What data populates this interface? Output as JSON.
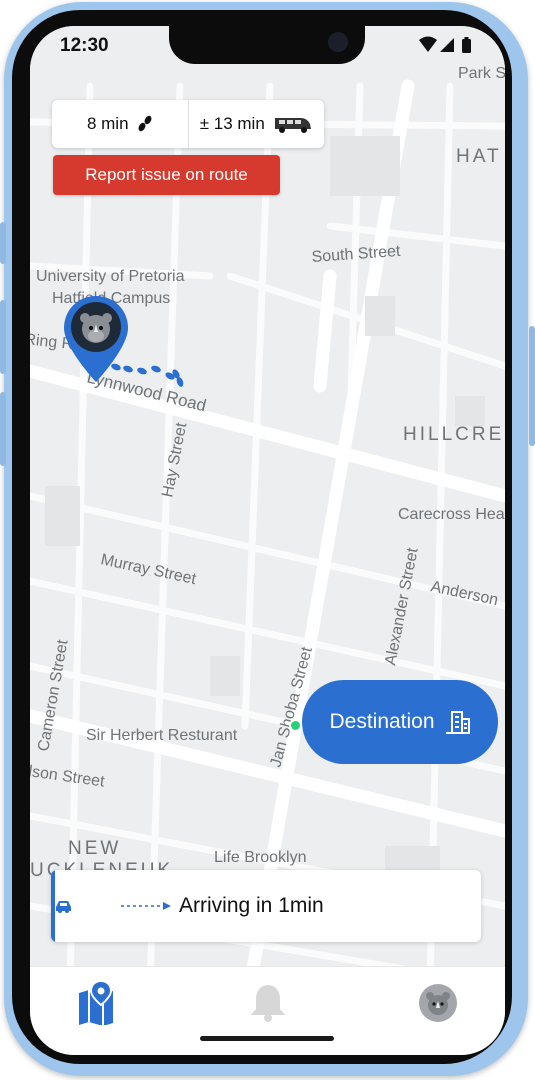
{
  "status_bar": {
    "time": "12:30"
  },
  "eta": {
    "walk": "8 min",
    "taxi": "± 13 min"
  },
  "report_button": {
    "label": "Report issue on route"
  },
  "map": {
    "labels": {
      "park": "Park S",
      "hat": "HAT",
      "south_street": "South Street",
      "university_1": "University of Pretoria",
      "university_2": "Hatfield Campus",
      "ring": "Ring R",
      "lynnwood": "Lynnwood Road",
      "hillcrest": "HILLCRE",
      "hay": "Hay Street",
      "carecross": "Carecross Hea",
      "murray": "Murray Street",
      "anderson": "Anderson",
      "alexander": "Alexander Street",
      "cameron": "Cameron Street",
      "jan_shoba": "Jan Shoba Street",
      "sir_herbert": "Sir Herbert Resturant",
      "nelson": "lson Street",
      "new": "NEW",
      "muckleneuk": "UCKLENEUK",
      "life_brooklyn": "Life Brooklyn"
    }
  },
  "destination": {
    "label": "Destination"
  },
  "arrival": {
    "text": "Arriving in 1min"
  },
  "colors": {
    "accent": "#2b6fd0",
    "report": "#d63a2e",
    "map_bg": "#eceeef"
  }
}
